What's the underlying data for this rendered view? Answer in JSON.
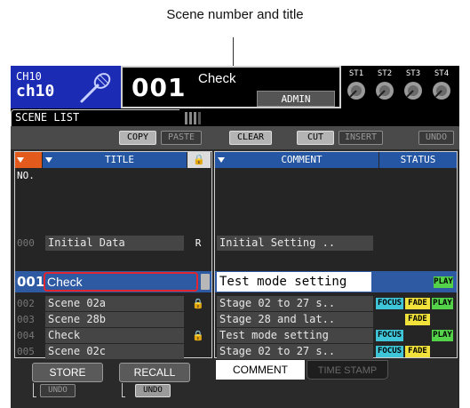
{
  "callout": {
    "label": "Scene number and title"
  },
  "header": {
    "channel_short": "CH10",
    "channel_name": "ch10",
    "scene_number": "001",
    "scene_title": "Check",
    "user": "ADMIN",
    "stereo_labels": [
      "ST1",
      "ST2",
      "ST3",
      "ST4"
    ]
  },
  "tabs": {
    "active": "SCENE LIST"
  },
  "toolbar": {
    "copy": "COPY",
    "paste": "PASTE",
    "clear": "CLEAR",
    "cut": "CUT",
    "insert": "INSERT",
    "undo": "UNDO"
  },
  "list": {
    "columns": {
      "no": "NO.",
      "title": "TITLE",
      "comment": "COMMENT",
      "status": "STATUS"
    },
    "lock_symbol": "🔒",
    "rows": [
      {
        "number": "000",
        "title": "Initial Data",
        "lock": "R",
        "comment": "Initial Setting ..",
        "focus": "",
        "fade": "",
        "play": ""
      },
      {
        "number": "002",
        "title": "Scene 02a",
        "lock": "🔒",
        "comment": "Stage 02 to 27 s..",
        "focus": "FOCUS",
        "fade": "FADE",
        "play": "PLAY"
      },
      {
        "number": "003",
        "title": "Scene 28b",
        "lock": "",
        "comment": "Stage 28 and lat..",
        "focus": "",
        "fade": "FADE",
        "play": ""
      },
      {
        "number": "004",
        "title": "Check",
        "lock": "🔒",
        "comment": "Test mode setting",
        "focus": "FOCUS",
        "fade": "",
        "play": "PLAY"
      },
      {
        "number": "005",
        "title": "Scene 02c",
        "lock": "",
        "comment": "Stage 02 to 27 s..",
        "focus": "FOCUS",
        "fade": "FADE",
        "play": ""
      }
    ],
    "selected": {
      "number": "001",
      "title": "Check",
      "comment": "Test mode setting",
      "play": "PLAY"
    }
  },
  "bottom": {
    "store": "STORE",
    "recall": "RECALL",
    "store_undo": "UNDO",
    "recall_undo": "UNDO",
    "tab_comment": "COMMENT",
    "tab_timestamp": "TIME STAMP"
  },
  "colors": {
    "channel_bg": "#1c2bb4",
    "header_blue": "#2456a4",
    "no_orange": "#e25a1c",
    "selected_row": "#2d5aa2",
    "focus_badge": "#3fc5d8",
    "fade_badge": "#f0e23a",
    "play_badge": "#53d24a",
    "selection_outline": "#e2252e"
  }
}
